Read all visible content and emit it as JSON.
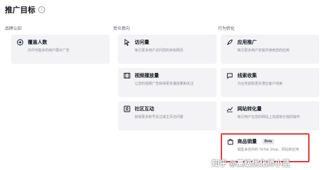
{
  "header": {
    "title": "推广目标",
    "info_icon": "info-circle-icon"
  },
  "columns": [
    {
      "label": "品牌认知"
    },
    {
      "label": "受众意向"
    },
    {
      "label": "行为转化"
    }
  ],
  "cards": {
    "reach": {
      "title": "覆盖人数",
      "desc": "向尽可能多的用户展示广告",
      "icon": "target-icon"
    },
    "traffic": {
      "title": "访问量",
      "desc": "吸引更多用户访问您的目标网页",
      "icon": "cursor-icon"
    },
    "video_views": {
      "title": "视频播放量",
      "desc": "让您的视频广告获得更多播放量和关注",
      "icon": "film-icon"
    },
    "community": {
      "title": "社区互动",
      "desc": "获得更多账号关注或主页访问量",
      "icon": "community-icon"
    },
    "app_promotion": {
      "title": "应用推广",
      "desc": "吸引更多用户安装并使用您的应用",
      "icon": "rocket-icon"
    },
    "lead_gen": {
      "title": "线索收集",
      "desc": "为业务获取更多潜在客户线索",
      "icon": "chat-icon"
    },
    "web_conversions": {
      "title": "网站转化量",
      "desc": "吸引用户在您的网站上完成有价值的操作",
      "icon": "chart-icon"
    },
    "product_sales": {
      "title": "商品销量",
      "badge": "Beta",
      "desc": "销售来自你的 TikTok Shop、网站和应用",
      "icon": "bag-icon"
    }
  },
  "watermark": "知乎 @高级优化师小蓝",
  "colors": {
    "selected_border": "#e43a3a",
    "card_bg": "#f3f3f5"
  }
}
